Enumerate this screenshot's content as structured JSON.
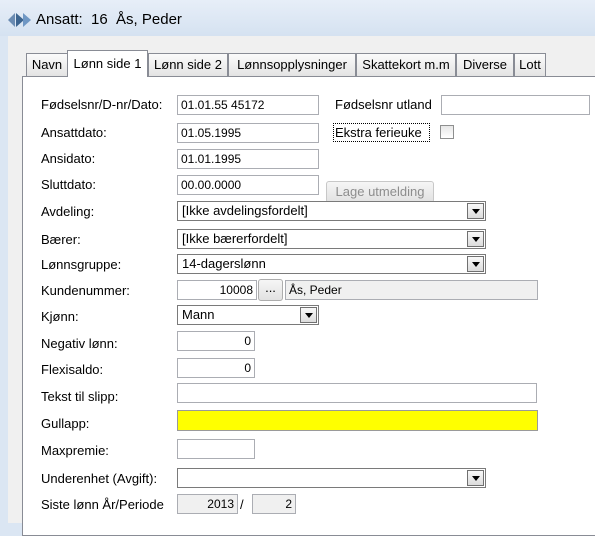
{
  "window": {
    "title": "Ansatt:  16  Ås, Peder"
  },
  "tabs": [
    {
      "label": "Navn",
      "active": false
    },
    {
      "label": "Lønn side 1",
      "active": true
    },
    {
      "label": "Lønn side 2",
      "active": false
    },
    {
      "label": "Lønnsopplysninger",
      "active": false
    },
    {
      "label": "Skattekort m.m",
      "active": false
    },
    {
      "label": "Diverse",
      "active": false
    },
    {
      "label": "Lott",
      "active": false
    }
  ],
  "form": {
    "fodselsnr": {
      "label": "Fødselsnr/D-nr/Dato:",
      "value": "01.01.55 45172"
    },
    "fodselsnr_utland": {
      "label": "Fødselsnr utland",
      "value": ""
    },
    "ansattdato": {
      "label": "Ansattdato:",
      "value": "01.05.1995"
    },
    "ekstra_ferieuke": {
      "label": "Ekstra ferieuke",
      "checked": false
    },
    "ansidato": {
      "label": "Ansidato:",
      "value": "01.01.1995"
    },
    "sluttdato": {
      "label": "Sluttdato:",
      "value": "00.00.0000"
    },
    "lage_utmelding": {
      "label": "Lage utmelding"
    },
    "avdeling": {
      "label": "Avdeling:",
      "value": "[Ikke avdelingsfordelt]"
    },
    "baerer": {
      "label": "Bærer:",
      "value": "[Ikke bærerfordelt]"
    },
    "lonnsgruppe": {
      "label": "Lønnsgruppe:",
      "value": "14-dagerslønn"
    },
    "kundenummer": {
      "label": "Kundenummer:",
      "value": "10008",
      "lookup_label": "...",
      "name": "Ås, Peder"
    },
    "kjonn": {
      "label": "Kjønn:",
      "value": "Mann"
    },
    "negativ_lonn": {
      "label": "Negativ lønn:",
      "value": "0"
    },
    "flexisaldo": {
      "label": "Flexisaldo:",
      "value": "0"
    },
    "tekst_til_slipp": {
      "label": "Tekst til slipp:",
      "value": ""
    },
    "gullapp": {
      "label": "Gullapp:",
      "value": "",
      "color": "#ffff00"
    },
    "maxpremie": {
      "label": "Maxpremie:",
      "value": ""
    },
    "underenhet": {
      "label": "Underenhet (Avgift):",
      "value": ""
    },
    "siste_lonn": {
      "label": "Siste lønn År/Periode",
      "year": "2013",
      "separator": "/",
      "period": "2"
    }
  }
}
